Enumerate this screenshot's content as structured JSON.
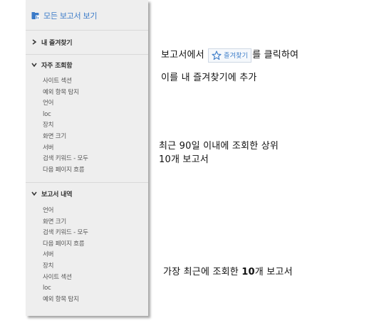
{
  "sidebar": {
    "all_reports_label": "모든 보고서 보기",
    "favorites_label": "내 즐겨찾기",
    "frequent_label": "자주 조회함",
    "frequent_items": [
      "사이트 섹션",
      "예외 항목 탐지",
      "언어",
      "loc",
      "장치",
      "화면 크기",
      "서버",
      "검색 키워드 - 모두",
      "다음 페이지 흐름"
    ],
    "history_label": "보고서 내역",
    "history_items": [
      "언어",
      "화면 크기",
      "검색 키워드 - 모두",
      "다음 페이지 흐름",
      "서버",
      "장치",
      "사이트 섹션",
      "loc",
      "예외 항목 탐지"
    ]
  },
  "notes": {
    "fav_line1_prefix": "보고서에서",
    "fav_chip_label": "즐겨찾기",
    "fav_line1_suffix": "를 클릭하여",
    "fav_line2": "이를 내 즐겨찾기에 추가",
    "frequent_line1": "최근 90일 이내에 조회한 상위",
    "frequent_line2": "10개 보고서",
    "history_prefix": "가장 최근에 조회한 ",
    "history_bold": "10",
    "history_suffix": "개 보고서"
  },
  "colors": {
    "link_blue": "#3b7bc8",
    "panel_bg": "#eeeeee"
  },
  "icons": [
    "report-folder-icon",
    "chevron-right-icon",
    "chevron-down-icon",
    "star-icon"
  ]
}
